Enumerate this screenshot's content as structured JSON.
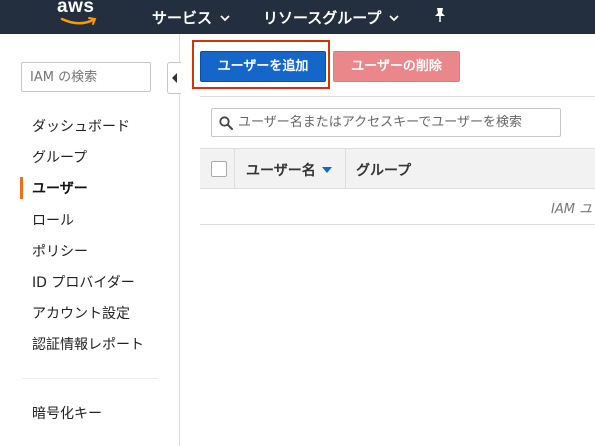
{
  "topbar": {
    "logo_text": "aws",
    "services_label": "サービス",
    "resource_groups_label": "リソースグループ",
    "pin_icon": "pin-icon"
  },
  "sidebar": {
    "search_placeholder": "IAM の検索",
    "items": [
      {
        "label": "ダッシュボード",
        "active": false
      },
      {
        "label": "グループ",
        "active": false
      },
      {
        "label": "ユーザー",
        "active": true
      },
      {
        "label": "ロール",
        "active": false
      },
      {
        "label": "ポリシー",
        "active": false
      },
      {
        "label": "ID プロバイダー",
        "active": false
      },
      {
        "label": "アカウント設定",
        "active": false
      },
      {
        "label": "認証情報レポート",
        "active": false
      }
    ],
    "bottom_items": [
      {
        "label": "暗号化キー"
      }
    ]
  },
  "main": {
    "add_user_label": "ユーザーを追加",
    "delete_user_label": "ユーザーの削除",
    "user_search_placeholder": "ユーザー名またはアクセスキーでユーザーを検索",
    "table": {
      "columns": [
        "ユーザー名",
        "グループ"
      ],
      "sort_indicator": "sort-down-icon"
    },
    "empty_text": "IAM ユ"
  },
  "colors": {
    "topbar_bg": "#232f3e",
    "primary_button": "#1466c9",
    "danger_button_disabled": "#e9878a",
    "active_accent": "#ec7211",
    "highlight_box": "#d13212"
  }
}
